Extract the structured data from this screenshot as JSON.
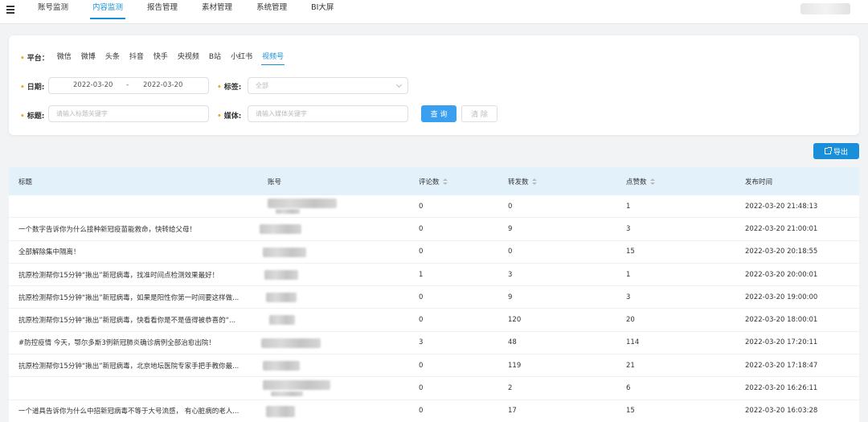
{
  "nav": {
    "items": [
      "账号监测",
      "内容监测",
      "报告管理",
      "素材管理",
      "系统管理",
      "BI大屏"
    ],
    "active_index": 1
  },
  "filters": {
    "platform_label": "平台：",
    "platforms": [
      "微信",
      "微博",
      "头条",
      "抖音",
      "快手",
      "央视频",
      "B站",
      "小红书",
      "视频号"
    ],
    "active_platform": "视频号",
    "date_label": "日期:",
    "date_start": "2022-03-20",
    "date_sep": "-",
    "date_end": "2022-03-20",
    "tag_label": "标签:",
    "tag_placeholder": "全部",
    "title_label": "标题:",
    "title_placeholder": "请输入标题关键字",
    "media_label": "媒体:",
    "media_placeholder": "请输入媒体关键字",
    "query_button": "查 询",
    "clear_button": "清 除"
  },
  "toolbar": {
    "export_button": "导出"
  },
  "table": {
    "columns": [
      "标题",
      "账号",
      "评论数",
      "转发数",
      "点赞数",
      "发布时间"
    ],
    "rows": [
      {
        "title": "",
        "comments": "0",
        "forwards": "0",
        "likes": "1",
        "time": "2022-03-20 21:48:13"
      },
      {
        "title": "一个数字告诉你为什么接种新冠疫苗能救命，快转给父母！",
        "comments": "0",
        "forwards": "9",
        "likes": "3",
        "time": "2022-03-20 21:00:01"
      },
      {
        "title": "全部解除集中隔离！",
        "comments": "0",
        "forwards": "0",
        "likes": "15",
        "time": "2022-03-20 20:18:55"
      },
      {
        "title": "抗原检测帮你15分钟“揪出”新冠病毒，找准时间点检测效果最好！",
        "comments": "1",
        "forwards": "3",
        "likes": "1",
        "time": "2022-03-20 20:00:01"
      },
      {
        "title": "抗原检测帮你15分钟“揪出”新冠病毒，如果是阳性你第一时间要这样做...",
        "comments": "0",
        "forwards": "9",
        "likes": "3",
        "time": "2022-03-20 19:00:00"
      },
      {
        "title": "抗原检测帮你15分钟“揪出”新冠病毒，快看看你是不是值得被恭喜的“...",
        "comments": "0",
        "forwards": "120",
        "likes": "20",
        "time": "2022-03-20 18:00:01"
      },
      {
        "title": "#防控疫情 今天，鄂尔多斯3例新冠肺炎确诊病例全部治愈出院！",
        "comments": "3",
        "forwards": "48",
        "likes": "114",
        "time": "2022-03-20 17:20:11"
      },
      {
        "title": "抗原检测帮你15分钟“揪出”新冠病毒，北京地坛医院专家手把手教你最...",
        "comments": "0",
        "forwards": "119",
        "likes": "21",
        "time": "2022-03-20 17:18:47"
      },
      {
        "title": "",
        "comments": "0",
        "forwards": "2",
        "likes": "6",
        "time": "2022-03-20 16:26:11"
      },
      {
        "title": "一个道具告诉你为什么中招新冠病毒不等于大号流感， 有心脏病的老人...",
        "comments": "0",
        "forwards": "17",
        "likes": "15",
        "time": "2022-03-20 16:03:28"
      }
    ]
  },
  "colors": {
    "accent": "#1a8fd9",
    "header_bg": "#e3f1fb",
    "required_mark": "#f5a623"
  }
}
